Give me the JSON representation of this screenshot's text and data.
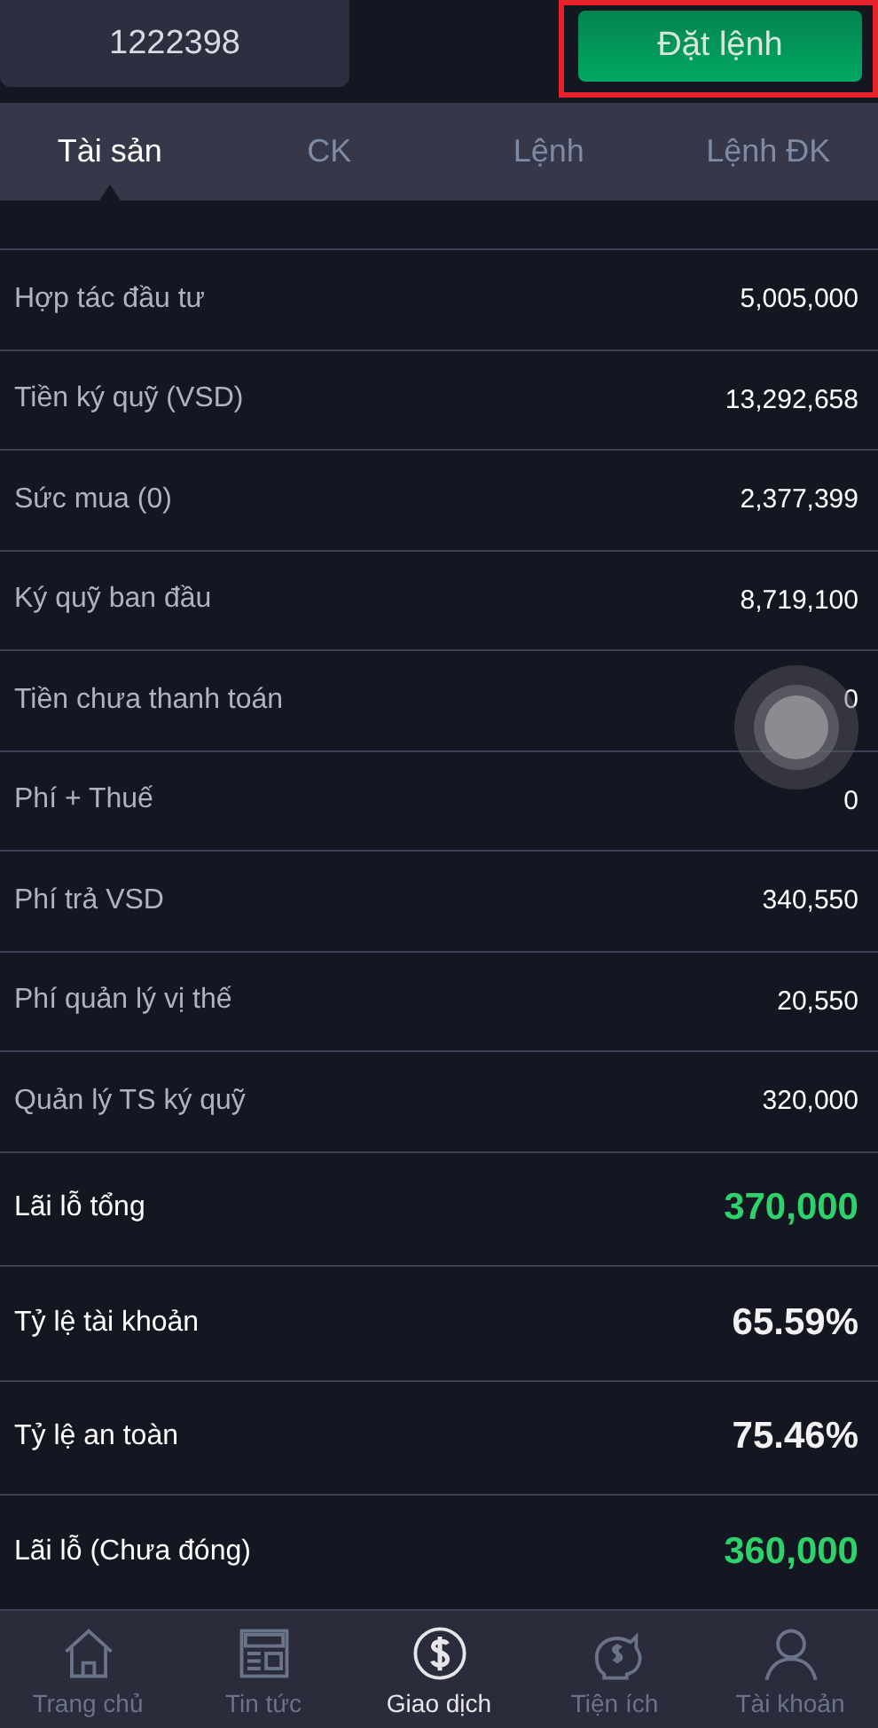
{
  "account": {
    "value": "1222398"
  },
  "order_button": {
    "label": "Đặt lệnh",
    "highlighted": true
  },
  "tabs": [
    {
      "label": "Tài sản",
      "selected": true
    },
    {
      "label": "CK",
      "selected": false
    },
    {
      "label": "Lệnh",
      "selected": false
    },
    {
      "label": "Lệnh ĐK",
      "selected": false
    }
  ],
  "rows": [
    {
      "kind": "plain",
      "label": "Hợp tác đầu tư",
      "value": "5,005,000"
    },
    {
      "kind": "plain",
      "label": "Tiền ký quỹ (VSD)",
      "value": "13,292,658"
    },
    {
      "kind": "plain",
      "label": "Sức mua (0)",
      "value": "2,377,399"
    },
    {
      "kind": "plain",
      "label": "Ký quỹ ban đầu",
      "value": "8,719,100"
    },
    {
      "kind": "plain",
      "label": "Tiền chưa thanh toán",
      "value": "0"
    },
    {
      "kind": "plain",
      "label": "Phí + Thuế",
      "value": "0"
    },
    {
      "kind": "plain",
      "label": "Phí trả VSD",
      "value": "340,550"
    },
    {
      "kind": "plain",
      "label": "Phí quản lý vị thế",
      "value": "20,550"
    },
    {
      "kind": "plain",
      "label": "Quản lý TS ký quỹ",
      "value": "320,000"
    },
    {
      "kind": "profit",
      "label": "Lãi lỗ tổng",
      "value": "370,000"
    },
    {
      "kind": "total",
      "label": "Tỷ lệ tài khoản",
      "value": "65.59%"
    },
    {
      "kind": "total",
      "label": "Tỷ lệ an toàn",
      "value": "75.46%"
    },
    {
      "kind": "profit",
      "label": "Lãi lỗ (Chưa đóng)",
      "value": "360,000"
    }
  ],
  "nav": [
    {
      "kind": "home",
      "label": "Trang chủ",
      "selected": false
    },
    {
      "kind": "news",
      "label": "Tin tức",
      "selected": false
    },
    {
      "kind": "dollar",
      "label": "Giao dịch",
      "selected": true
    },
    {
      "kind": "piggy",
      "label": "Tiện ích",
      "selected": false
    },
    {
      "kind": "person",
      "label": "Tài khoản",
      "selected": false
    }
  ]
}
